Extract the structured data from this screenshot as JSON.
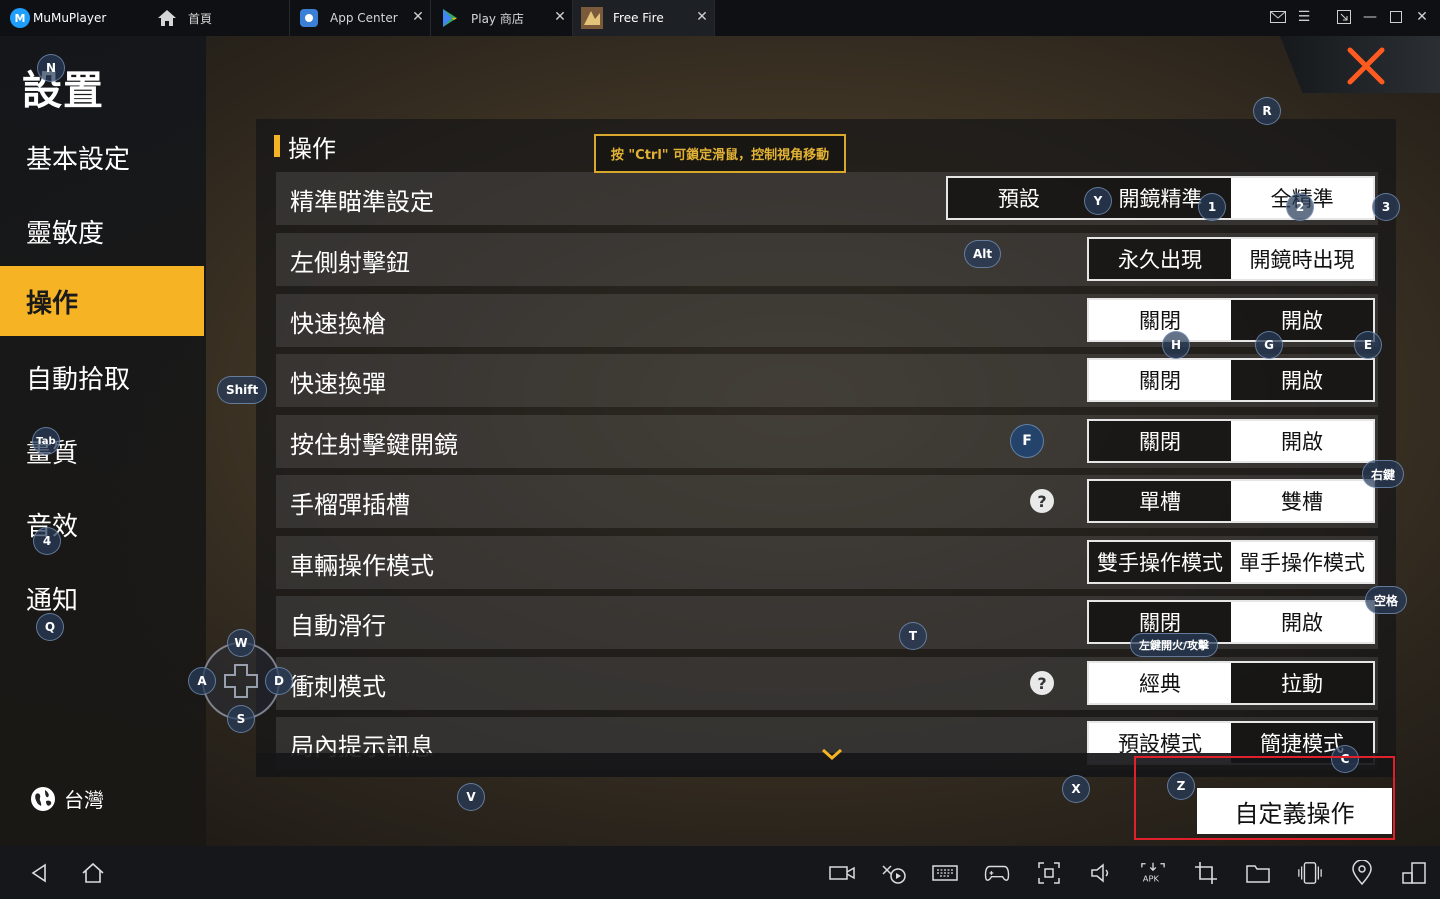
{
  "titlebar": {
    "app_name": "MuMuPlayer",
    "tabs": [
      {
        "label": "首頁"
      },
      {
        "label": "App Center"
      },
      {
        "label": "Play 商店"
      },
      {
        "label": "Free Fire"
      }
    ]
  },
  "sidebar": {
    "title": "設置",
    "items": [
      {
        "label": "基本設定"
      },
      {
        "label": "靈敏度"
      },
      {
        "label": "操作"
      },
      {
        "label": "自動拾取"
      },
      {
        "label": "畫質"
      },
      {
        "label": "音效"
      },
      {
        "label": "通知"
      }
    ],
    "region": "台灣"
  },
  "hint": "按 \"Ctrl\" 可鎖定滑鼠，控制視角移動",
  "section_title": "操作",
  "settings": [
    {
      "label": "精準瞄準設定",
      "options": [
        "預設",
        "開鏡精準",
        "全精準"
      ]
    },
    {
      "label": "左側射擊鈕",
      "options": [
        "永久出現",
        "開鏡時出現"
      ]
    },
    {
      "label": "快速換槍",
      "options": [
        "關閉",
        "開啟"
      ]
    },
    {
      "label": "快速換彈",
      "options": [
        "關閉",
        "開啟"
      ]
    },
    {
      "label": "按住射擊鍵開鏡",
      "options": [
        "關閉",
        "開啟"
      ]
    },
    {
      "label": "手榴彈插槽",
      "options": [
        "單槽",
        "雙槽"
      ]
    },
    {
      "label": "車輛操作模式",
      "options": [
        "雙手操作模式",
        "單手操作模式"
      ]
    },
    {
      "label": "自動滑行",
      "options": [
        "關閉",
        "開啟"
      ]
    },
    {
      "label": "衝刺模式",
      "options": [
        "經典",
        "拉動"
      ]
    },
    {
      "label": "局內提示訊息",
      "options": [
        "預設模式",
        "簡捷模式"
      ]
    }
  ],
  "custom_button": "自定義操作",
  "key_hints": {
    "R": "R",
    "Y": "Y",
    "k1": "1",
    "k2": "2",
    "k3": "3",
    "Alt": "Alt",
    "H": "H",
    "G": "G",
    "E": "E",
    "Shift": "Shift",
    "F": "F",
    "right": "右鍵",
    "k4": "4",
    "Q": "Q",
    "W": "W",
    "A": "A",
    "S": "S",
    "D": "D",
    "T": "T",
    "space": "空格",
    "fire": "左鍵開火/攻擊",
    "V": "V",
    "X": "X",
    "Z": "Z",
    "C": "C",
    "N": "N",
    "Tab": "Tab"
  }
}
